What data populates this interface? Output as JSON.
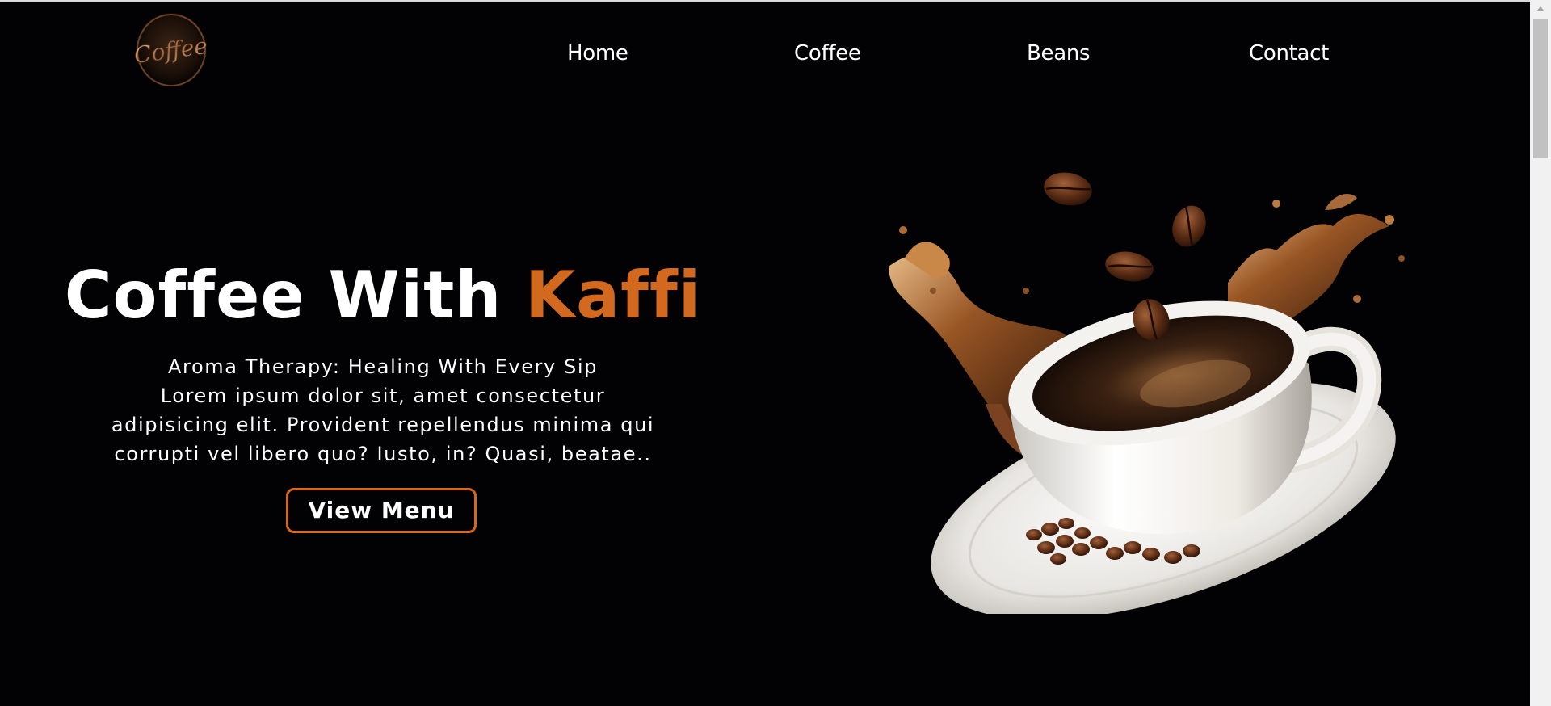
{
  "brand": {
    "logo_text": "Coffee",
    "accent_color": "#d2691e",
    "background_color": "#020204"
  },
  "nav": {
    "items": [
      {
        "label": "Home"
      },
      {
        "label": "Coffee"
      },
      {
        "label": "Beans"
      },
      {
        "label": "Contact"
      }
    ]
  },
  "hero": {
    "title_main": "Coffee With ",
    "title_accent": "Kaffi",
    "subtitle_lines": [
      "Aroma Therapy: Healing With Every Sip",
      "Lorem ipsum dolor sit, amet consectetur",
      "adipisicing elit. Provident repellendus minima qui",
      "corrupti vel libero quo? Iusto, in? Quasi, beatae.."
    ],
    "cta_label": "View Menu"
  },
  "icons": {
    "logo": "coffee-logo-icon",
    "hero_image": "coffee-cup-splash-image",
    "scroll_up": "scroll-up-arrow-icon"
  }
}
